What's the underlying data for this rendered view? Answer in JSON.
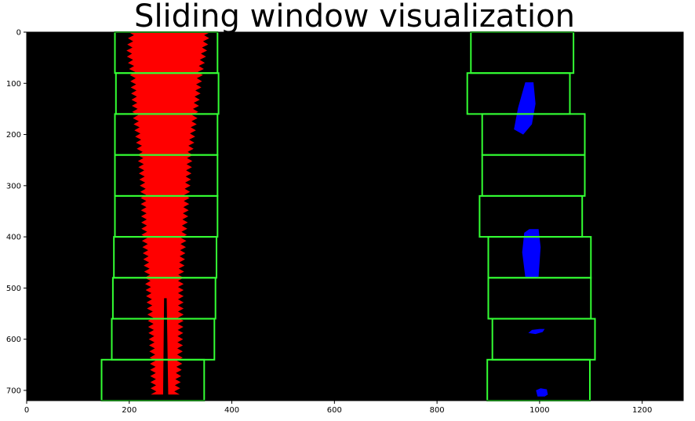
{
  "chart_data": {
    "type": "image",
    "title": "Sliding window visualization",
    "xlabel": "",
    "ylabel": "",
    "xlim": [
      0,
      1280
    ],
    "ylim": [
      720,
      0
    ],
    "x_ticks": [
      0,
      200,
      400,
      600,
      800,
      1000,
      1200
    ],
    "y_ticks": [
      0,
      100,
      200,
      300,
      400,
      500,
      600,
      700
    ],
    "colors": {
      "background": "#000000",
      "window": "#33ff33",
      "left_lane": "#ff0000",
      "right_lane": "#0000ff"
    },
    "windows": {
      "left": [
        {
          "x1": 172,
          "x2": 372,
          "y1": 0,
          "y2": 80
        },
        {
          "x1": 174,
          "x2": 374,
          "y1": 80,
          "y2": 160
        },
        {
          "x1": 172,
          "x2": 372,
          "y1": 160,
          "y2": 240
        },
        {
          "x1": 172,
          "x2": 372,
          "y1": 240,
          "y2": 320
        },
        {
          "x1": 172,
          "x2": 372,
          "y1": 320,
          "y2": 400
        },
        {
          "x1": 170,
          "x2": 370,
          "y1": 400,
          "y2": 480
        },
        {
          "x1": 168,
          "x2": 368,
          "y1": 480,
          "y2": 560
        },
        {
          "x1": 166,
          "x2": 366,
          "y1": 560,
          "y2": 640
        },
        {
          "x1": 146,
          "x2": 346,
          "y1": 640,
          "y2": 720
        }
      ],
      "right": [
        {
          "x1": 866,
          "x2": 1066,
          "y1": 0,
          "y2": 80
        },
        {
          "x1": 859,
          "x2": 1059,
          "y1": 80,
          "y2": 160
        },
        {
          "x1": 888,
          "x2": 1088,
          "y1": 160,
          "y2": 240
        },
        {
          "x1": 888,
          "x2": 1088,
          "y1": 240,
          "y2": 320
        },
        {
          "x1": 883,
          "x2": 1083,
          "y1": 320,
          "y2": 400
        },
        {
          "x1": 900,
          "x2": 1100,
          "y1": 400,
          "y2": 480
        },
        {
          "x1": 900,
          "x2": 1100,
          "y1": 480,
          "y2": 560
        },
        {
          "x1": 908,
          "x2": 1108,
          "y1": 560,
          "y2": 640
        },
        {
          "x1": 898,
          "x2": 1098,
          "y1": 640,
          "y2": 720
        }
      ]
    },
    "left_lane_band": [
      {
        "y": 0,
        "x1": 205,
        "x2": 352
      },
      {
        "y": 40,
        "x1": 200,
        "x2": 345
      },
      {
        "y": 80,
        "x1": 207,
        "x2": 338
      },
      {
        "y": 160,
        "x1": 212,
        "x2": 328
      },
      {
        "y": 240,
        "x1": 222,
        "x2": 318
      },
      {
        "y": 320,
        "x1": 228,
        "x2": 312
      },
      {
        "y": 400,
        "x1": 230,
        "x2": 306
      },
      {
        "y": 480,
        "x1": 236,
        "x2": 300
      },
      {
        "y": 560,
        "x1": 242,
        "x2": 300
      },
      {
        "y": 640,
        "x1": 246,
        "x2": 298
      },
      {
        "y": 712,
        "x1": 248,
        "x2": 292
      }
    ],
    "right_lane_blobs": [
      {
        "points": [
          [
            958,
            148
          ],
          [
            972,
            98
          ],
          [
            988,
            98
          ],
          [
            992,
            140
          ],
          [
            985,
            180
          ],
          [
            968,
            200
          ],
          [
            950,
            190
          ]
        ]
      },
      {
        "points": [
          [
            970,
            392
          ],
          [
            980,
            385
          ],
          [
            998,
            385
          ],
          [
            1002,
            420
          ],
          [
            998,
            478
          ],
          [
            985,
            480
          ],
          [
            972,
            478
          ],
          [
            966,
            430
          ]
        ]
      },
      {
        "points": [
          [
            978,
            588
          ],
          [
            985,
            582
          ],
          [
            1000,
            580
          ],
          [
            1010,
            580
          ],
          [
            1006,
            586
          ],
          [
            992,
            590
          ]
        ]
      },
      {
        "points": [
          [
            993,
            700
          ],
          [
            1002,
            696
          ],
          [
            1014,
            698
          ],
          [
            1016,
            708
          ],
          [
            1010,
            712
          ],
          [
            996,
            712
          ]
        ]
      }
    ]
  }
}
